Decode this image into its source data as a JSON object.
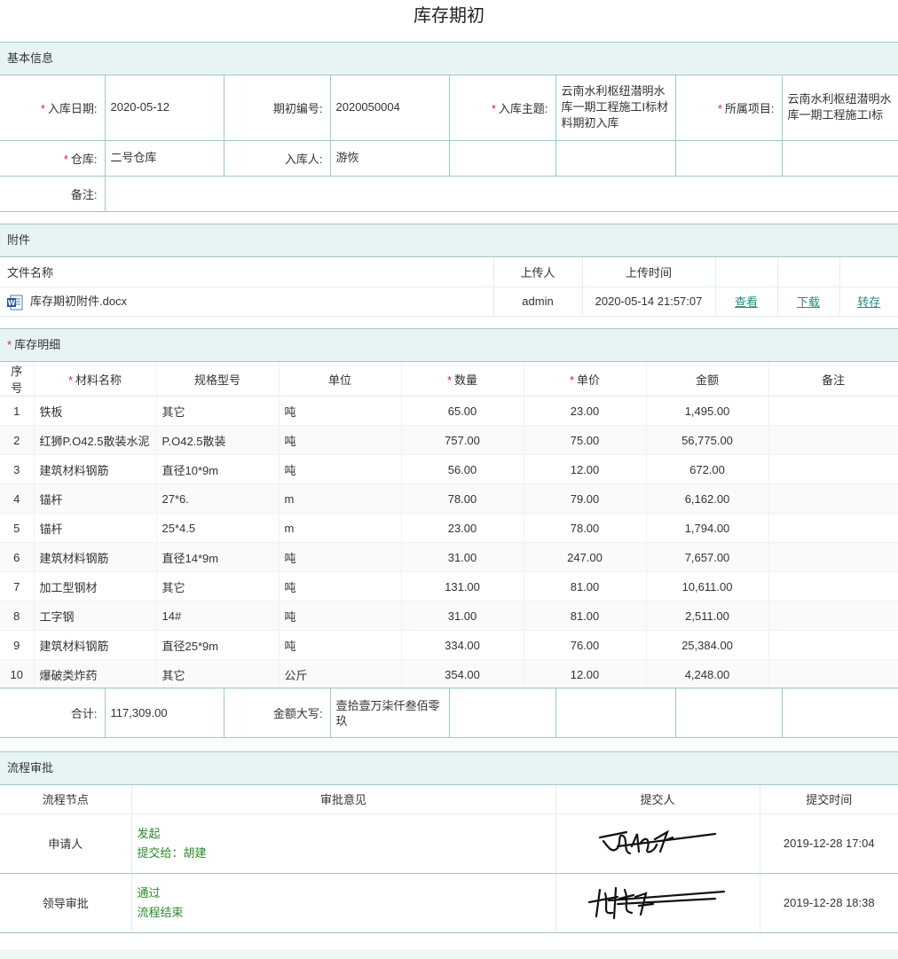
{
  "title": "库存期初",
  "basic": {
    "section_title": "基本信息",
    "date_label": "入库日期:",
    "date_value": "2020-05-12",
    "code_label": "期初编号:",
    "code_value": "2020050004",
    "subject_label": "入库主题:",
    "subject_value": "云南水利枢纽潜明水库一期工程施工I标材料期初入库",
    "project_label": "所属项目:",
    "project_value": "云南水利枢纽潜明水库一期工程施工I标",
    "warehouse_label": "仓库:",
    "warehouse_value": "二号仓库",
    "receiver_label": "入库人:",
    "receiver_value": "游恢",
    "remark_label": "备注:",
    "remark_value": ""
  },
  "attachments": {
    "section_title": "附件",
    "headers": {
      "name": "文件名称",
      "uploader": "上传人",
      "time": "上传时间"
    },
    "file": {
      "name": "库存期初附件.docx",
      "uploader": "admin",
      "time": "2020-05-14 21:57:07",
      "view": "查看",
      "download": "下载",
      "save": "转存",
      "icon": "word-doc-icon"
    }
  },
  "detail": {
    "section_title": "库存明细",
    "headers": {
      "no": "序号",
      "name": "材料名称",
      "spec": "规格型号",
      "unit": "单位",
      "qty": "数量",
      "price": "单价",
      "amount": "金额",
      "remark": "备注"
    },
    "rows": [
      {
        "no": "1",
        "name": "铁板",
        "spec": "其它",
        "unit": "吨",
        "qty": "65.00",
        "price": "23.00",
        "amount": "1,495.00",
        "remark": ""
      },
      {
        "no": "2",
        "name": "红狮P.O42.5散装水泥",
        "spec": "P.O42.5散装",
        "unit": "吨",
        "qty": "757.00",
        "price": "75.00",
        "amount": "56,775.00",
        "remark": ""
      },
      {
        "no": "3",
        "name": "建筑材料钢筋",
        "spec": "直径10*9m",
        "unit": "吨",
        "qty": "56.00",
        "price": "12.00",
        "amount": "672.00",
        "remark": ""
      },
      {
        "no": "4",
        "name": "锚杆",
        "spec": "27*6.",
        "unit": "m",
        "qty": "78.00",
        "price": "79.00",
        "amount": "6,162.00",
        "remark": ""
      },
      {
        "no": "5",
        "name": "锚杆",
        "spec": "25*4.5",
        "unit": "m",
        "qty": "23.00",
        "price": "78.00",
        "amount": "1,794.00",
        "remark": ""
      },
      {
        "no": "6",
        "name": "建筑材料钢筋",
        "spec": "直径14*9m",
        "unit": "吨",
        "qty": "31.00",
        "price": "247.00",
        "amount": "7,657.00",
        "remark": ""
      },
      {
        "no": "7",
        "name": "加工型钢材",
        "spec": "其它",
        "unit": "吨",
        "qty": "131.00",
        "price": "81.00",
        "amount": "10,611.00",
        "remark": ""
      },
      {
        "no": "8",
        "name": "工字钢",
        "spec": "14#",
        "unit": "吨",
        "qty": "31.00",
        "price": "81.00",
        "amount": "2,511.00",
        "remark": ""
      },
      {
        "no": "9",
        "name": "建筑材料钢筋",
        "spec": "直径25*9m",
        "unit": "吨",
        "qty": "334.00",
        "price": "76.00",
        "amount": "25,384.00",
        "remark": ""
      },
      {
        "no": "10",
        "name": "爆破类炸药",
        "spec": "其它",
        "unit": "公斤",
        "qty": "354.00",
        "price": "12.00",
        "amount": "4,248.00",
        "remark": ""
      }
    ]
  },
  "total": {
    "sum_label": "合计:",
    "sum_value": "117,309.00",
    "upper_label": "金额大写:",
    "upper_value": "壹拾壹万柒仟叁佰零玖"
  },
  "approval": {
    "section_title": "流程审批",
    "headers": {
      "node": "流程节点",
      "opinion": "审批意见",
      "submitter": "提交人",
      "time": "提交时间"
    },
    "rows": [
      {
        "node": "申请人",
        "opinion1": "发起",
        "opinion2": "提交给：胡建",
        "time": "2019-12-28 17:04"
      },
      {
        "node": "领导审批",
        "opinion1": "通过",
        "opinion2": "流程结束",
        "time": "2019-12-28 18:38"
      }
    ]
  }
}
